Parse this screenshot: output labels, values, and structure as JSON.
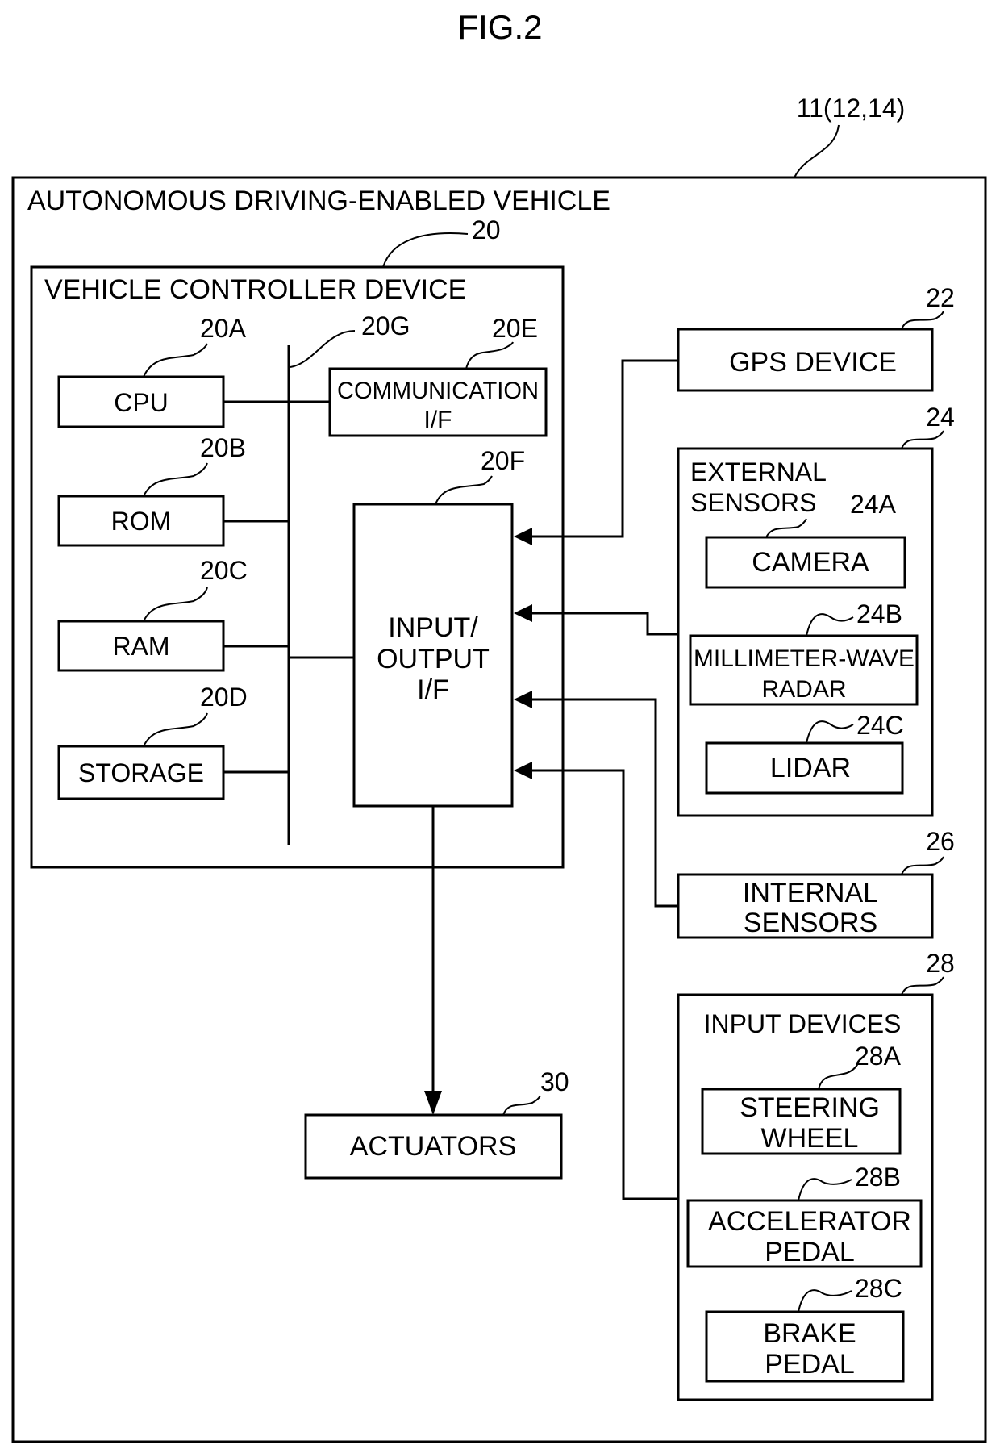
{
  "figure": {
    "title": "FIG.2",
    "vehicle_ref": "11(12,14)",
    "vehicle_label": "AUTONOMOUS DRIVING-ENABLED VEHICLE"
  },
  "controller": {
    "ref": "20",
    "label": "VEHICLE CONTROLLER DEVICE",
    "bus_ref": "20G",
    "cpu": {
      "ref": "20A",
      "label": "CPU"
    },
    "rom": {
      "ref": "20B",
      "label": "ROM"
    },
    "ram": {
      "ref": "20C",
      "label": "RAM"
    },
    "storage": {
      "ref": "20D",
      "label": "STORAGE"
    },
    "comm": {
      "ref": "20E",
      "line1": "COMMUNICATION",
      "line2": "I/F"
    },
    "io": {
      "ref": "20F",
      "line1": "INPUT/",
      "line2": "OUTPUT",
      "line3": "I/F"
    }
  },
  "gps": {
    "ref": "22",
    "label": "GPS DEVICE"
  },
  "external": {
    "ref": "24",
    "line1": "EXTERNAL",
    "line2": "SENSORS",
    "camera": {
      "ref": "24A",
      "label": "CAMERA"
    },
    "radar": {
      "ref": "24B",
      "line1": "MILLIMETER-WAVE",
      "line2": "RADAR"
    },
    "lidar": {
      "ref": "24C",
      "label": "LIDAR"
    }
  },
  "internal": {
    "ref": "26",
    "line1": "INTERNAL",
    "line2": "SENSORS"
  },
  "input_devices": {
    "ref": "28",
    "label": "INPUT DEVICES",
    "steering": {
      "ref": "28A",
      "line1": "STEERING",
      "line2": "WHEEL"
    },
    "accel": {
      "ref": "28B",
      "line1": "ACCELERATOR",
      "line2": "PEDAL"
    },
    "brake": {
      "ref": "28C",
      "line1": "BRAKE",
      "line2": "PEDAL"
    }
  },
  "actuators": {
    "ref": "30",
    "label": "ACTUATORS"
  }
}
